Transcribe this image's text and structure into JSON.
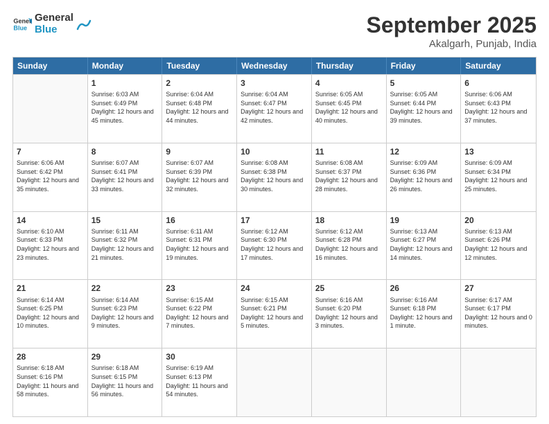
{
  "header": {
    "logo_general": "General",
    "logo_blue": "Blue",
    "title": "September 2025",
    "subtitle": "Akalgarh, Punjab, India"
  },
  "days_of_week": [
    "Sunday",
    "Monday",
    "Tuesday",
    "Wednesday",
    "Thursday",
    "Friday",
    "Saturday"
  ],
  "weeks": [
    [
      {
        "day": "",
        "sunrise": "",
        "sunset": "",
        "daylight": ""
      },
      {
        "day": "1",
        "sunrise": "Sunrise: 6:03 AM",
        "sunset": "Sunset: 6:49 PM",
        "daylight": "Daylight: 12 hours and 45 minutes."
      },
      {
        "day": "2",
        "sunrise": "Sunrise: 6:04 AM",
        "sunset": "Sunset: 6:48 PM",
        "daylight": "Daylight: 12 hours and 44 minutes."
      },
      {
        "day": "3",
        "sunrise": "Sunrise: 6:04 AM",
        "sunset": "Sunset: 6:47 PM",
        "daylight": "Daylight: 12 hours and 42 minutes."
      },
      {
        "day": "4",
        "sunrise": "Sunrise: 6:05 AM",
        "sunset": "Sunset: 6:45 PM",
        "daylight": "Daylight: 12 hours and 40 minutes."
      },
      {
        "day": "5",
        "sunrise": "Sunrise: 6:05 AM",
        "sunset": "Sunset: 6:44 PM",
        "daylight": "Daylight: 12 hours and 39 minutes."
      },
      {
        "day": "6",
        "sunrise": "Sunrise: 6:06 AM",
        "sunset": "Sunset: 6:43 PM",
        "daylight": "Daylight: 12 hours and 37 minutes."
      }
    ],
    [
      {
        "day": "7",
        "sunrise": "Sunrise: 6:06 AM",
        "sunset": "Sunset: 6:42 PM",
        "daylight": "Daylight: 12 hours and 35 minutes."
      },
      {
        "day": "8",
        "sunrise": "Sunrise: 6:07 AM",
        "sunset": "Sunset: 6:41 PM",
        "daylight": "Daylight: 12 hours and 33 minutes."
      },
      {
        "day": "9",
        "sunrise": "Sunrise: 6:07 AM",
        "sunset": "Sunset: 6:39 PM",
        "daylight": "Daylight: 12 hours and 32 minutes."
      },
      {
        "day": "10",
        "sunrise": "Sunrise: 6:08 AM",
        "sunset": "Sunset: 6:38 PM",
        "daylight": "Daylight: 12 hours and 30 minutes."
      },
      {
        "day": "11",
        "sunrise": "Sunrise: 6:08 AM",
        "sunset": "Sunset: 6:37 PM",
        "daylight": "Daylight: 12 hours and 28 minutes."
      },
      {
        "day": "12",
        "sunrise": "Sunrise: 6:09 AM",
        "sunset": "Sunset: 6:36 PM",
        "daylight": "Daylight: 12 hours and 26 minutes."
      },
      {
        "day": "13",
        "sunrise": "Sunrise: 6:09 AM",
        "sunset": "Sunset: 6:34 PM",
        "daylight": "Daylight: 12 hours and 25 minutes."
      }
    ],
    [
      {
        "day": "14",
        "sunrise": "Sunrise: 6:10 AM",
        "sunset": "Sunset: 6:33 PM",
        "daylight": "Daylight: 12 hours and 23 minutes."
      },
      {
        "day": "15",
        "sunrise": "Sunrise: 6:11 AM",
        "sunset": "Sunset: 6:32 PM",
        "daylight": "Daylight: 12 hours and 21 minutes."
      },
      {
        "day": "16",
        "sunrise": "Sunrise: 6:11 AM",
        "sunset": "Sunset: 6:31 PM",
        "daylight": "Daylight: 12 hours and 19 minutes."
      },
      {
        "day": "17",
        "sunrise": "Sunrise: 6:12 AM",
        "sunset": "Sunset: 6:30 PM",
        "daylight": "Daylight: 12 hours and 17 minutes."
      },
      {
        "day": "18",
        "sunrise": "Sunrise: 6:12 AM",
        "sunset": "Sunset: 6:28 PM",
        "daylight": "Daylight: 12 hours and 16 minutes."
      },
      {
        "day": "19",
        "sunrise": "Sunrise: 6:13 AM",
        "sunset": "Sunset: 6:27 PM",
        "daylight": "Daylight: 12 hours and 14 minutes."
      },
      {
        "day": "20",
        "sunrise": "Sunrise: 6:13 AM",
        "sunset": "Sunset: 6:26 PM",
        "daylight": "Daylight: 12 hours and 12 minutes."
      }
    ],
    [
      {
        "day": "21",
        "sunrise": "Sunrise: 6:14 AM",
        "sunset": "Sunset: 6:25 PM",
        "daylight": "Daylight: 12 hours and 10 minutes."
      },
      {
        "day": "22",
        "sunrise": "Sunrise: 6:14 AM",
        "sunset": "Sunset: 6:23 PM",
        "daylight": "Daylight: 12 hours and 9 minutes."
      },
      {
        "day": "23",
        "sunrise": "Sunrise: 6:15 AM",
        "sunset": "Sunset: 6:22 PM",
        "daylight": "Daylight: 12 hours and 7 minutes."
      },
      {
        "day": "24",
        "sunrise": "Sunrise: 6:15 AM",
        "sunset": "Sunset: 6:21 PM",
        "daylight": "Daylight: 12 hours and 5 minutes."
      },
      {
        "day": "25",
        "sunrise": "Sunrise: 6:16 AM",
        "sunset": "Sunset: 6:20 PM",
        "daylight": "Daylight: 12 hours and 3 minutes."
      },
      {
        "day": "26",
        "sunrise": "Sunrise: 6:16 AM",
        "sunset": "Sunset: 6:18 PM",
        "daylight": "Daylight: 12 hours and 1 minute."
      },
      {
        "day": "27",
        "sunrise": "Sunrise: 6:17 AM",
        "sunset": "Sunset: 6:17 PM",
        "daylight": "Daylight: 12 hours and 0 minutes."
      }
    ],
    [
      {
        "day": "28",
        "sunrise": "Sunrise: 6:18 AM",
        "sunset": "Sunset: 6:16 PM",
        "daylight": "Daylight: 11 hours and 58 minutes."
      },
      {
        "day": "29",
        "sunrise": "Sunrise: 6:18 AM",
        "sunset": "Sunset: 6:15 PM",
        "daylight": "Daylight: 11 hours and 56 minutes."
      },
      {
        "day": "30",
        "sunrise": "Sunrise: 6:19 AM",
        "sunset": "Sunset: 6:13 PM",
        "daylight": "Daylight: 11 hours and 54 minutes."
      },
      {
        "day": "",
        "sunrise": "",
        "sunset": "",
        "daylight": ""
      },
      {
        "day": "",
        "sunrise": "",
        "sunset": "",
        "daylight": ""
      },
      {
        "day": "",
        "sunrise": "",
        "sunset": "",
        "daylight": ""
      },
      {
        "day": "",
        "sunrise": "",
        "sunset": "",
        "daylight": ""
      }
    ]
  ]
}
